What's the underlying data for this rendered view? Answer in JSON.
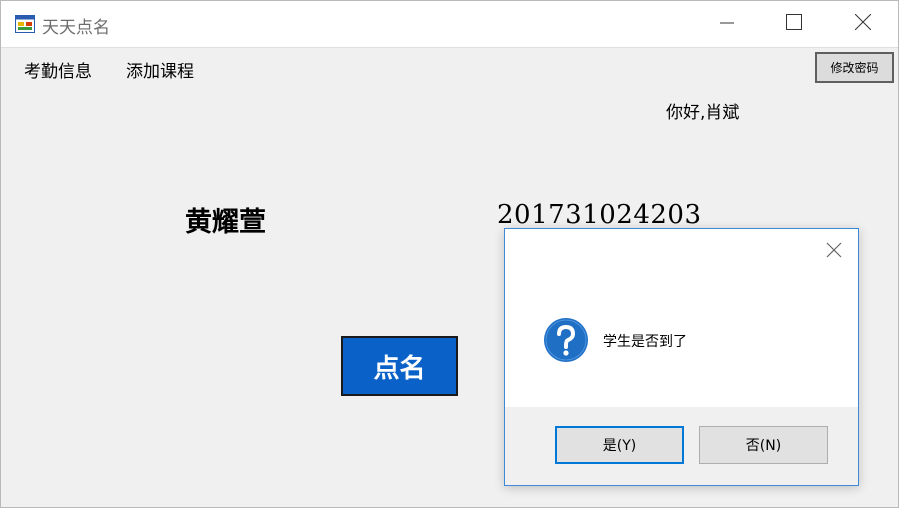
{
  "window": {
    "title": "天天点名",
    "icon": "app-form-icon"
  },
  "controls": {
    "minimize": "minimize-icon",
    "maximize": "maximize-icon",
    "close": "close-icon"
  },
  "menu": {
    "items": [
      {
        "label": "考勤信息"
      },
      {
        "label": "添加课程"
      }
    ]
  },
  "toolbar": {
    "change_password_label": "修改密码"
  },
  "greeting": "你好,肖斌",
  "student": {
    "name": "黄耀萱",
    "id": "201731024203"
  },
  "rollcall_button_label": "点名",
  "dialog": {
    "message": "学生是否到了",
    "icon": "question-icon",
    "yes_label": "是(Y)",
    "no_label": "否(N)"
  },
  "colors": {
    "accent": "#0a62c9",
    "dialog_border": "#3c8ad6",
    "question_icon": "#1f6fc5",
    "focus": "#0078d7"
  }
}
